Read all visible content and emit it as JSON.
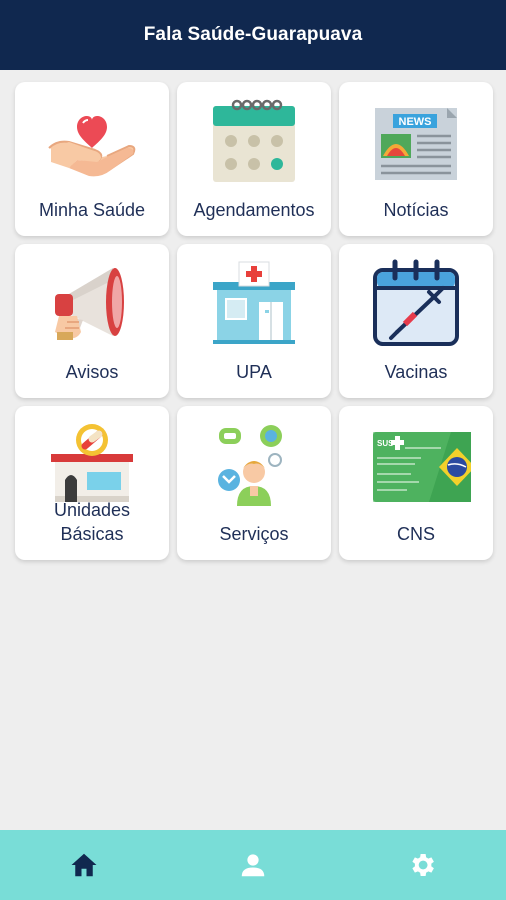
{
  "header": {
    "title": "Fala Saúde-Guarapuava"
  },
  "tiles": [
    {
      "label": "Minha Saúde",
      "icon": "hand-heart-icon"
    },
    {
      "label": "Agendamentos",
      "icon": "calendar-icon"
    },
    {
      "label": "Notícias",
      "icon": "newspaper-icon"
    },
    {
      "label": "Avisos",
      "icon": "megaphone-icon"
    },
    {
      "label": "UPA",
      "icon": "clinic-building-icon"
    },
    {
      "label": "Vacinas",
      "icon": "vaccine-calendar-icon"
    },
    {
      "label": "Unidades\nBásicas",
      "icon": "health-unit-store-icon"
    },
    {
      "label": "Serviços",
      "icon": "chat-services-icon"
    },
    {
      "label": "CNS",
      "icon": "sus-card-icon"
    }
  ],
  "icon_text": {
    "news": "NEWS",
    "sus": "SUS"
  },
  "bottom_nav": [
    {
      "icon": "home-icon",
      "active": true
    },
    {
      "icon": "user-icon",
      "active": false
    },
    {
      "icon": "gear-icon",
      "active": false
    }
  ],
  "colors": {
    "header_bg": "#10284f",
    "nav_bg": "#79ddd7",
    "nav_active": "#10284f",
    "nav_inactive": "#ffffff"
  }
}
